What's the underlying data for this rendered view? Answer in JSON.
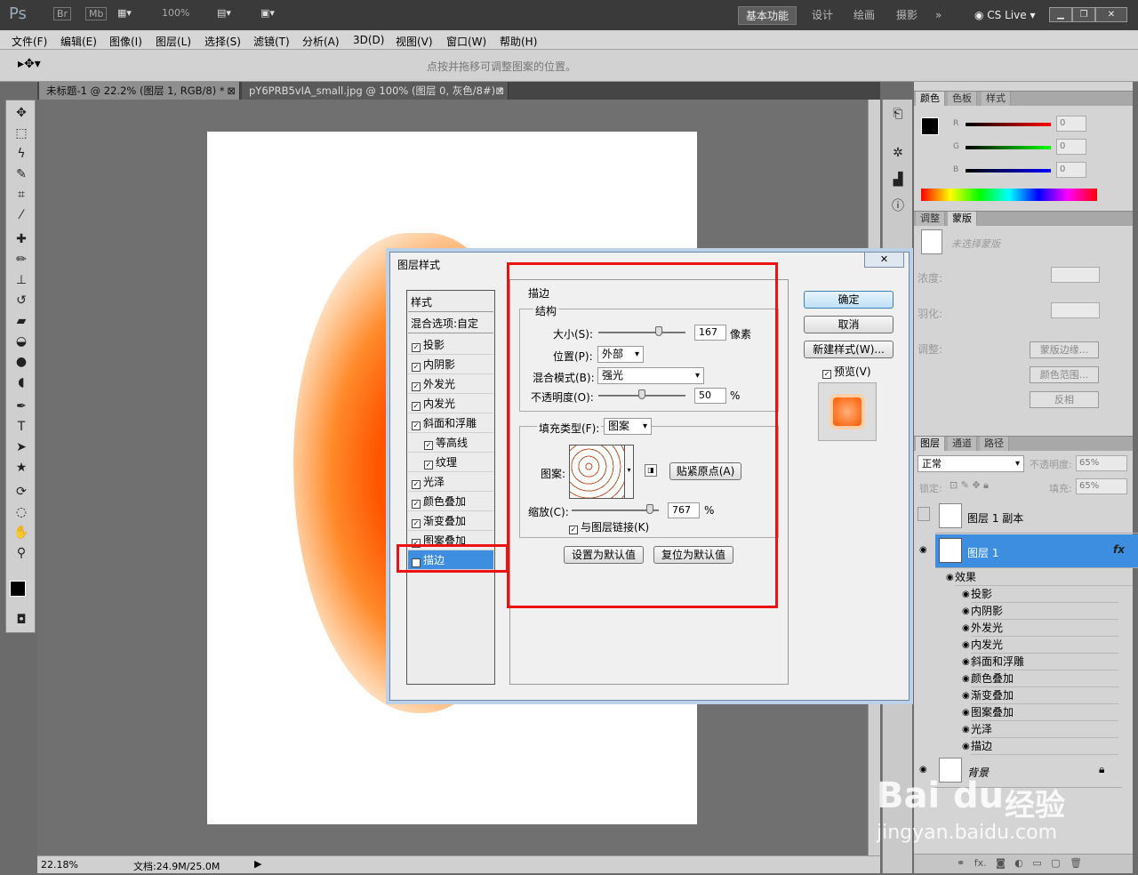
{
  "appbar": {
    "logo": "Ps",
    "br": "Br",
    "mb": "Mb",
    "zoom": "100%",
    "workspaces": [
      "基本功能",
      "设计",
      "绘画",
      "摄影"
    ],
    "more": "»",
    "cslive": "CS Live"
  },
  "menu": [
    "文件(F)",
    "编辑(E)",
    "图像(I)",
    "图层(L)",
    "选择(S)",
    "滤镜(T)",
    "分析(A)",
    "3D(D)",
    "视图(V)",
    "窗口(W)",
    "帮助(H)"
  ],
  "options": {
    "hint": "点按并拖移可调整图案的位置。"
  },
  "tabs": [
    "未标题-1 @ 22.2% (图层 1, RGB/8) *",
    "pY6PRB5vIA_small.jpg @ 100% (图层 0, 灰色/8#) *"
  ],
  "status": {
    "zoom": "22.18%",
    "doc": "文档:24.9M/25.0M"
  },
  "colorpanel": {
    "tabs": [
      "颜色",
      "色板",
      "样式"
    ],
    "r": "R",
    "g": "G",
    "b": "B",
    "rv": "0",
    "gv": "0",
    "bv": "0"
  },
  "maskpanel": {
    "tabs": [
      "调整",
      "蒙版"
    ],
    "nomask": "未选择蒙版",
    "density": "浓度:",
    "feather": "羽化:",
    "adjust": "调整:",
    "btn1": "蒙版边缘...",
    "btn2": "颜色范围...",
    "btn3": "反相"
  },
  "layerspanel": {
    "tabs": [
      "图层",
      "通道",
      "路径"
    ],
    "blend": "正常",
    "opacity_label": "不透明度:",
    "opacity": "65%",
    "lock": "锁定:",
    "fill_label": "填充:",
    "fill": "65%",
    "layers": [
      {
        "name": "图层 1 副本"
      },
      {
        "name": "图层 1",
        "fx": "fx"
      }
    ],
    "effects_label": "效果",
    "effects": [
      "投影",
      "内阴影",
      "外发光",
      "内发光",
      "斜面和浮雕",
      "颜色叠加",
      "渐变叠加",
      "图案叠加",
      "光泽",
      "描边"
    ],
    "bg": "背景"
  },
  "dialog": {
    "title": "图层样式",
    "close": "✕",
    "styles_header": "样式",
    "blend_options": "混合选项:自定",
    "items": [
      {
        "label": "投影",
        "indent": false
      },
      {
        "label": "内阴影",
        "indent": false
      },
      {
        "label": "外发光",
        "indent": false
      },
      {
        "label": "内发光",
        "indent": false
      },
      {
        "label": "斜面和浮雕",
        "indent": false
      },
      {
        "label": "等高线",
        "indent": true
      },
      {
        "label": "纹理",
        "indent": true
      },
      {
        "label": "光泽",
        "indent": false
      },
      {
        "label": "颜色叠加",
        "indent": false
      },
      {
        "label": "渐变叠加",
        "indent": false
      },
      {
        "label": "图案叠加",
        "indent": false
      },
      {
        "label": "描边",
        "indent": false,
        "selected": true
      }
    ],
    "section": "描边",
    "structure": "结构",
    "size_label": "大小(S):",
    "size": "167",
    "size_unit": "像素",
    "position_label": "位置(P):",
    "position": "外部",
    "blend_label": "混合模式(B):",
    "blend": "强光",
    "opacity_label": "不透明度(O):",
    "opacity": "50",
    "opacity_unit": "%",
    "filltype_label": "填充类型(F):",
    "filltype": "图案",
    "pattern_label": "图案:",
    "snap": "贴紧原点(A)",
    "scale_label": "缩放(C):",
    "scale": "767",
    "scale_unit": "%",
    "link": "与图层链接(K)",
    "set_default": "设置为默认值",
    "reset_default": "复位为默认值",
    "ok": "确定",
    "cancel": "取消",
    "new_style": "新建样式(W)...",
    "preview": "预览(V)"
  },
  "watermark": {
    "brand": "Bai",
    "brand2": "du",
    "suffix": "经验",
    "url": "jingyan.baidu.com"
  }
}
